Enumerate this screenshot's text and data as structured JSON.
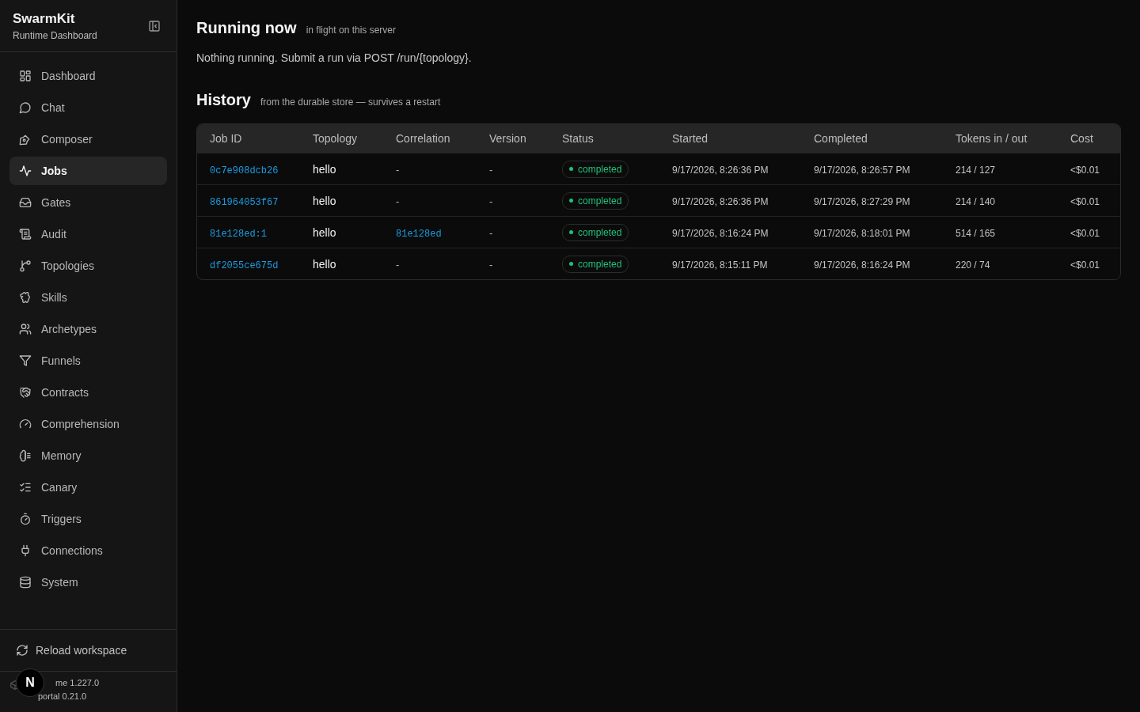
{
  "sidebar": {
    "brand": "SwarmKit",
    "subtitle": "Runtime Dashboard",
    "items": [
      {
        "label": "Dashboard",
        "selected": false
      },
      {
        "label": "Chat",
        "selected": false
      },
      {
        "label": "Composer",
        "selected": false
      },
      {
        "label": "Jobs",
        "selected": true
      },
      {
        "label": "Gates",
        "selected": false
      },
      {
        "label": "Audit",
        "selected": false
      },
      {
        "label": "Topologies",
        "selected": false
      },
      {
        "label": "Skills",
        "selected": false
      },
      {
        "label": "Archetypes",
        "selected": false
      },
      {
        "label": "Funnels",
        "selected": false
      },
      {
        "label": "Contracts",
        "selected": false
      },
      {
        "label": "Comprehension",
        "selected": false
      },
      {
        "label": "Memory",
        "selected": false
      },
      {
        "label": "Canary",
        "selected": false
      },
      {
        "label": "Triggers",
        "selected": false
      },
      {
        "label": "Connections",
        "selected": false
      },
      {
        "label": "System",
        "selected": false
      }
    ],
    "reload": "Reload workspace",
    "version_1": "me 1.227.0",
    "version_2": "portal 0.21.0",
    "badge": "N"
  },
  "running": {
    "title": "Running now",
    "subtitle": "in flight on this server",
    "message": "Nothing running. Submit a run via POST /run/{topology}."
  },
  "history": {
    "title": "History",
    "subtitle": "from the durable store — survives a restart",
    "columns": [
      "Job ID",
      "Topology",
      "Correlation",
      "Version",
      "Status",
      "Started",
      "Completed",
      "Tokens in / out",
      "Cost"
    ],
    "rows": [
      {
        "job_id": "0c7e908dcb26",
        "topology": "hello",
        "correlation": {
          "kind": "empty",
          "text": "-"
        },
        "version": "-",
        "status": "completed",
        "started": "9/17/2026, 8:26:36 PM",
        "completed": "9/17/2026, 8:26:57 PM",
        "tokens": "214 / 127",
        "cost": "<$0.01"
      },
      {
        "job_id": "861964053f67",
        "topology": "hello",
        "correlation": {
          "kind": "empty",
          "text": "-"
        },
        "version": "-",
        "status": "completed",
        "started": "9/17/2026, 8:26:36 PM",
        "completed": "9/17/2026, 8:27:29 PM",
        "tokens": "214 / 140",
        "cost": "<$0.01"
      },
      {
        "job_id": "81e128ed:1",
        "topology": "hello",
        "correlation": {
          "kind": "link",
          "text": "81e128ed"
        },
        "version": "-",
        "status": "completed",
        "started": "9/17/2026, 8:16:24 PM",
        "completed": "9/17/2026, 8:18:01 PM",
        "tokens": "514 / 165",
        "cost": "<$0.01"
      },
      {
        "job_id": "df2055ce675d",
        "topology": "hello",
        "correlation": {
          "kind": "empty",
          "text": "-"
        },
        "version": "-",
        "status": "completed",
        "started": "9/17/2026, 8:15:11 PM",
        "completed": "9/17/2026, 8:16:24 PM",
        "tokens": "220 / 74",
        "cost": "<$0.01"
      }
    ]
  }
}
